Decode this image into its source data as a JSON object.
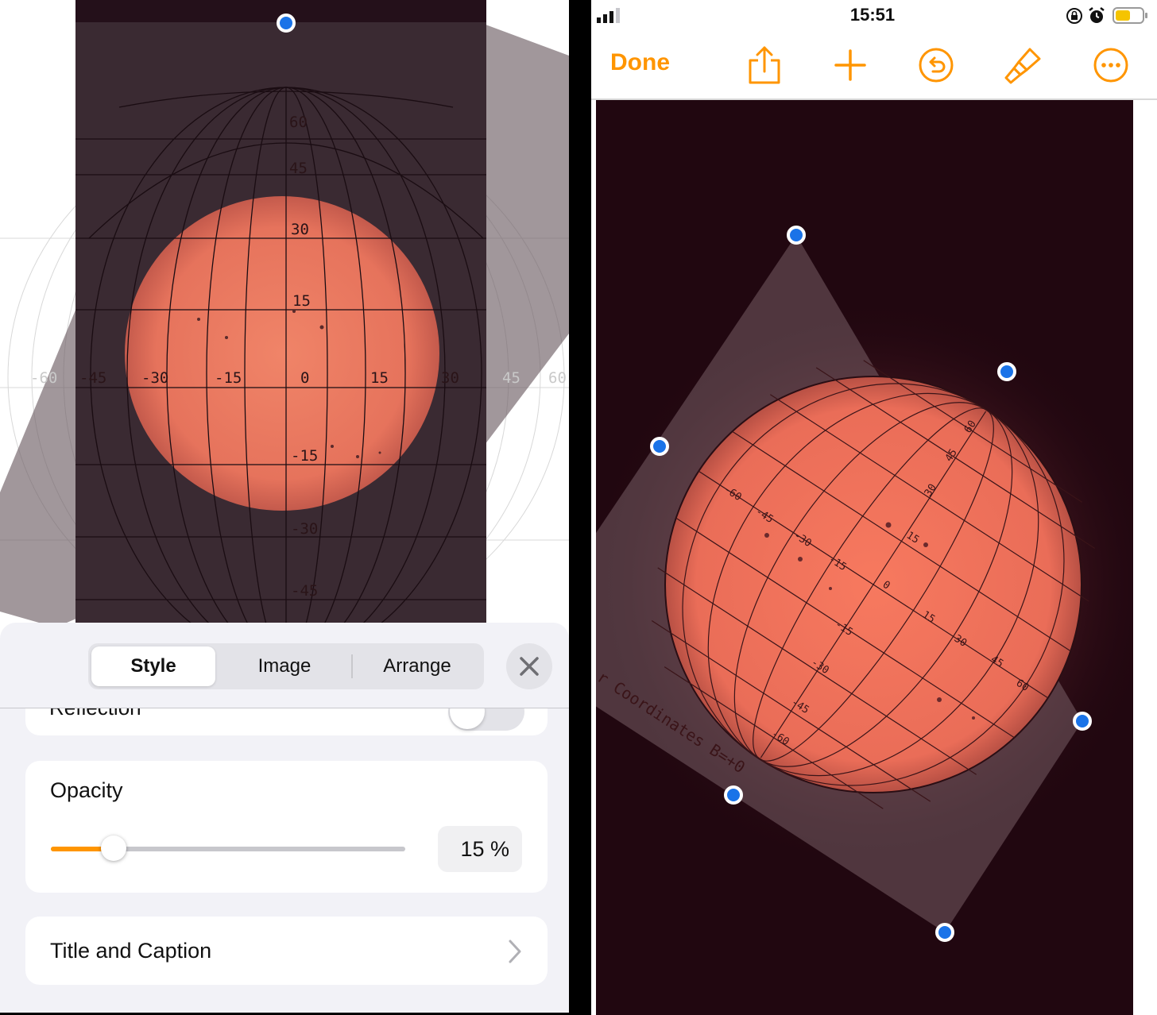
{
  "left": {
    "grid_labels": {
      "lat": [
        "60",
        "45",
        "30",
        "15",
        "-15",
        "-30",
        "-45"
      ],
      "lon": [
        "-60",
        "-45",
        "-30",
        "-15",
        "0",
        "15",
        "30",
        "45",
        "60"
      ]
    },
    "inspector": {
      "tabs": [
        {
          "label": "Style",
          "selected": true
        },
        {
          "label": "Image",
          "selected": false
        },
        {
          "label": "Arrange",
          "selected": false
        }
      ],
      "reflection_label": "Reflection",
      "opacity": {
        "label": "Opacity",
        "value_text": "15 %",
        "value": 0.15
      },
      "title_caption_label": "Title and Caption"
    }
  },
  "right": {
    "status": {
      "time": "15:51"
    },
    "toolbar": {
      "done_label": "Done",
      "icons": [
        "share-icon",
        "add-icon",
        "undo-icon",
        "format-brush-icon",
        "more-icon"
      ],
      "accent": "#ff9500"
    },
    "grid_labels": {
      "lat": [
        "60",
        "45",
        "30",
        "15",
        "0",
        "-15",
        "-30",
        "-45",
        "-60"
      ],
      "lon": [
        "-60",
        "-45",
        "-30",
        "-15",
        "0",
        "15",
        "30",
        "45",
        "60"
      ]
    },
    "overlay_caption": "r Coordinates  B=+0"
  },
  "colors": {
    "sun": "#e9735e",
    "sky": "#210710",
    "handle": "#1a73e8"
  }
}
